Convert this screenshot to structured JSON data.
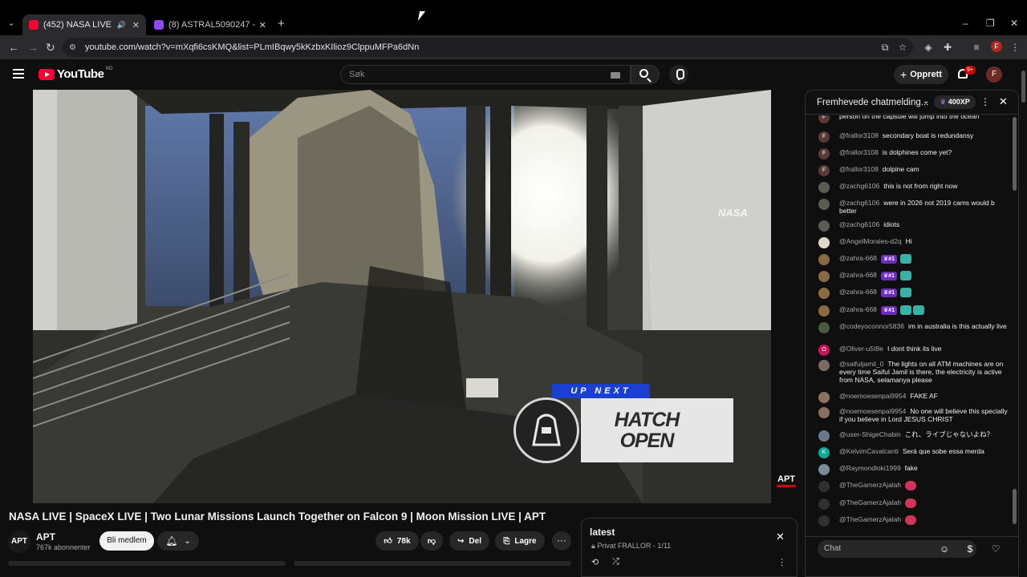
{
  "browser": {
    "tabs": [
      {
        "title": "(452) NASA LIVE | SpaceX LIVE",
        "active": true
      },
      {
        "title": "(8) ASTRAL5090247 - Twitch",
        "active": false
      }
    ],
    "url": "youtube.com/watch?v=mXqfi6csKMQ&list=PLmIBqwy5kKzbxKIlioz9ClppuMFPa6dNn",
    "profile_initial": "F"
  },
  "youtube": {
    "logo_text": "YouTube",
    "country_code": "NO",
    "search_placeholder": "Søk",
    "create_label": "Opprett",
    "notifications_badge": "9+",
    "avatar_initial": "F"
  },
  "video": {
    "title": "NASA LIVE | SpaceX LIVE | Two Lunar Missions Launch Together on Falcon 9 | Moon Mission LIVE | APT",
    "overlay_up_next": "UP NEXT",
    "overlay_card_line1": "HATCH",
    "overlay_card_line2": "OPEN",
    "nasa_watermark": "NASA",
    "channel_watermark": "APT"
  },
  "channel": {
    "avatar_text": "APT",
    "name": "APT",
    "subscribers": "767k abonnenter",
    "join_label": "Bli medlem"
  },
  "actions": {
    "likes": "78k",
    "share_label": "Del",
    "save_label": "Lagre"
  },
  "playlist": {
    "title": "latest",
    "meta": "Privat  FRALLOR - 1/11"
  },
  "chat": {
    "header_title": "Fremhevede chatmelding...",
    "xp_label": "400XP",
    "input_placeholder": "Chat",
    "messages": [
      {
        "author": "",
        "text": "person on the capsule will jump into the ocean",
        "avatar": "F",
        "color": "#5a3a35"
      },
      {
        "author": "@frallor3108",
        "text": "secondary boat is redundansy",
        "avatar": "F",
        "color": "#5a3a35"
      },
      {
        "author": "@frallor3108",
        "text": "is dolphines come yet?",
        "avatar": "F",
        "color": "#5a3a35"
      },
      {
        "author": "@frallor3108",
        "text": "dolpine cam",
        "avatar": "F",
        "color": "#5a3a35"
      },
      {
        "author": "@zachg6106",
        "text": "this is not from right now",
        "avatar": "",
        "color": "#5c5c52"
      },
      {
        "author": "@zachg6106",
        "text": "were in 2026 not 2019 cams would b better",
        "avatar": "",
        "color": "#5c5c52"
      },
      {
        "author": "@zachg6106",
        "text": "idiots",
        "avatar": "",
        "color": "#5c5c52"
      },
      {
        "author": "@AngelMorales-d2q",
        "text": "Hi",
        "avatar": "",
        "color": "#e0d8c8"
      },
      {
        "author": "@zahra-668",
        "text": "",
        "avatar": "",
        "color": "#8a6a40",
        "rank": "#1"
      },
      {
        "author": "@zahra-668",
        "text": "",
        "avatar": "",
        "color": "#8a6a40",
        "rank": "#1"
      },
      {
        "author": "@zahra-668",
        "text": "",
        "avatar": "",
        "color": "#8a6a40",
        "rank": "#1"
      },
      {
        "author": "@zahra-668",
        "text": "",
        "avatar": "",
        "color": "#8a6a40",
        "rank": "#1"
      },
      {
        "author": "@codeyoconnor5836",
        "text": "im in australia is this actually live",
        "avatar": "",
        "color": "#4a5a3a"
      },
      {
        "author": "@Oliver-u5t8e",
        "text": "I dont think its live",
        "avatar": "O",
        "color": "#c2185b"
      },
      {
        "author": "@saifuljamil_0",
        "text": "The lights on all ATM machines are on every time Saiful Jamil is there, the electricity is active from NASA, selamanya please",
        "avatar": "",
        "color": "#7a6a60"
      },
      {
        "author": "@noemoesenpai9954",
        "text": "FAKE AF",
        "avatar": "",
        "color": "#8a7060"
      },
      {
        "author": "@noemoesenpai9954",
        "text": "No one will believe this specially if you believe in Lord JESUS CHRIST",
        "avatar": "",
        "color": "#8a7060"
      },
      {
        "author": "@user-ShigeChabin",
        "text": "これ、ライブじゃないよね？",
        "avatar": "",
        "color": "#6a7a8a"
      },
      {
        "author": "@KelvimCavalcanti",
        "text": "Será que sobe essa merda",
        "avatar": "K",
        "color": "#12a89a"
      },
      {
        "author": "@Raymondloki1999",
        "text": "fake",
        "avatar": "",
        "color": "#7a8a9a"
      },
      {
        "author": "@TheGamerzAjalah",
        "text": "",
        "avatar": "",
        "color": "#303030"
      },
      {
        "author": "@TheGamerzAjalah",
        "text": "",
        "avatar": "",
        "color": "#303030"
      },
      {
        "author": "@TheGamerzAjalah",
        "text": "",
        "avatar": "",
        "color": "#303030"
      }
    ]
  },
  "colors": {
    "accent_red": "#ff0033",
    "rank_purple": "#6f2dbd",
    "upnext_blue": "#1b3fd0"
  }
}
